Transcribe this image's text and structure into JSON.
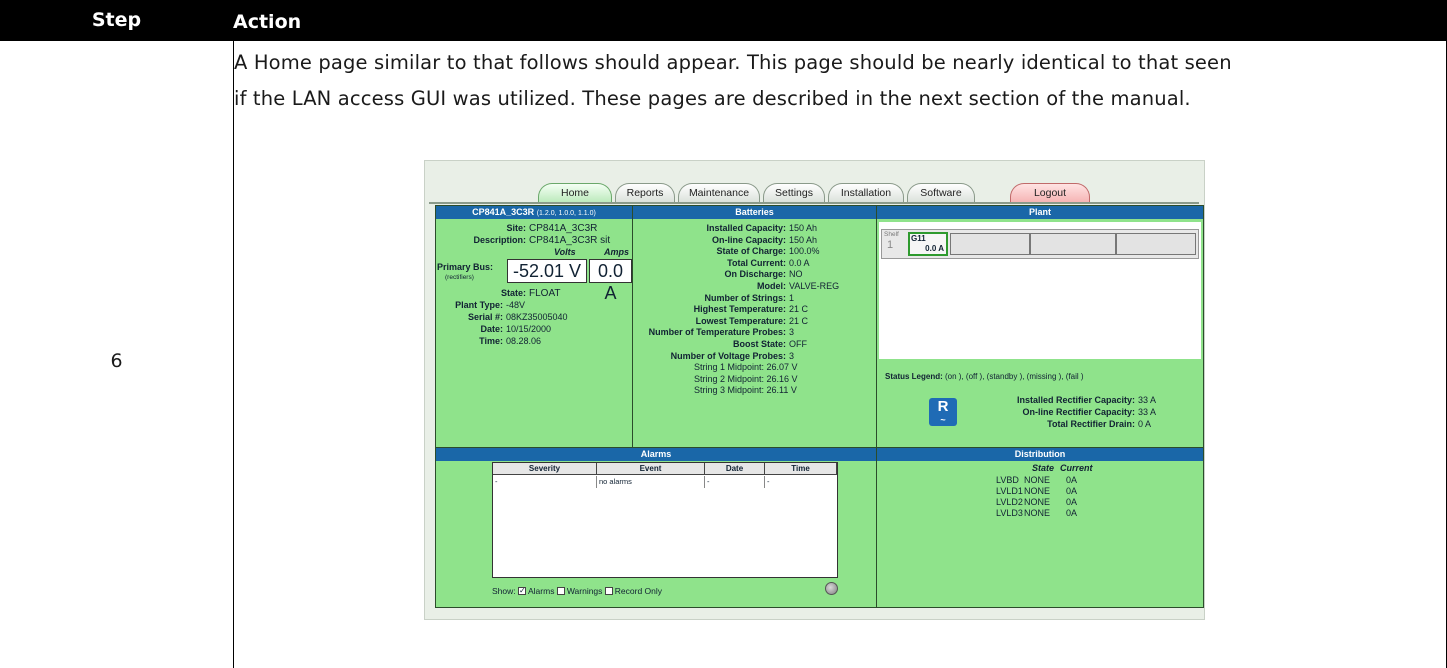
{
  "table": {
    "headers": [
      "Step",
      "Action"
    ],
    "step": "6",
    "paragraph_lines": [
      "A Home page similar to that follows should appear. This page should be nearly identical to that seen",
      "if the LAN access GUI was utilized. These pages are described in the next section of the manual."
    ]
  },
  "gui": {
    "tabs": [
      "Home",
      "Reports",
      "Maintenance",
      "Settings",
      "Installation",
      "Software",
      "Logout"
    ],
    "active_tab": "Home",
    "left": {
      "title": "CP841A_3C3R",
      "title_sub": "(1.2.0, 1.0.0, 1.1.0)",
      "site_label": "Site:",
      "site": "CP841A_3C3R",
      "desc_label": "Description:",
      "desc": "CP841A_3C3R sit",
      "volts_hdr": "Volts",
      "amps_hdr": "Amps",
      "bus_label": "Primary Bus:",
      "bus_sub": "(rectifiers)",
      "bus_volts": "-52.01 V",
      "bus_amps": "0.0 A",
      "state_label": "State:",
      "state": "FLOAT",
      "plant_type_label": "Plant Type:",
      "plant_type": "-48V",
      "serial_label": "Serial #:",
      "serial": "08KZ35005040",
      "date_label": "Date:",
      "date": "10/15/2000",
      "time_label": "Time:",
      "time": "08.28.06"
    },
    "batteries": {
      "title": "Batteries",
      "rows": [
        {
          "label": "Installed Capacity:",
          "value": "150 Ah"
        },
        {
          "label": "On-line Capacity:",
          "value": "150 Ah"
        },
        {
          "label": "State of Charge:",
          "value": "100.0%"
        },
        {
          "label": "Total Current:",
          "value": "0.0 A"
        },
        {
          "label": "On Discharge:",
          "value": "NO"
        },
        {
          "label": "Model:",
          "value": "VALVE-REG"
        },
        {
          "label": "Number of Strings:",
          "value": "1"
        },
        {
          "label": "Highest Temperature:",
          "value": "21 C"
        },
        {
          "label": "Lowest Temperature:",
          "value": "21 C"
        },
        {
          "label": "Number of Temperature Probes:",
          "value": "3"
        },
        {
          "label": "Boost State:",
          "value": "OFF"
        },
        {
          "label": "Number of Voltage Probes:",
          "value": "3"
        }
      ],
      "midpoints": [
        "String 1 Midpoint: 26.07 V",
        "String 2 Midpoint: 26.16 V",
        "String 3 Midpoint: 26.11 V"
      ]
    },
    "plant": {
      "title": "Plant",
      "shelf_label": "Shelf",
      "shelf_num": "1",
      "rect_id": "G11",
      "rect_amps": "0.0 A",
      "legend_label": "Status Legend:",
      "legend_text": "(on ), (off ), (standby ), (missing ), (fail )",
      "rows": [
        {
          "label": "Installed Rectifier Capacity:",
          "value": "33 A"
        },
        {
          "label": "On-line Rectifier Capacity:",
          "value": "33 A"
        },
        {
          "label": "Total Rectifier Drain:",
          "value": "0 A"
        }
      ],
      "logo_letter": "R"
    },
    "alarms": {
      "title": "Alarms",
      "columns": [
        "Severity",
        "Event",
        "Date",
        "Time"
      ],
      "row": [
        "-",
        "no alarms",
        "-",
        "-"
      ],
      "show_label": "Show:",
      "checks": [
        {
          "label": "Alarms",
          "checked": true
        },
        {
          "label": "Warnings",
          "checked": false
        },
        {
          "label": "Record Only",
          "checked": false
        }
      ]
    },
    "distribution": {
      "title": "Distribution",
      "state_hdr": "State",
      "current_hdr": "Current",
      "rows": [
        {
          "name": "LVBD",
          "state": "NONE",
          "current": "0A"
        },
        {
          "name": "LVLD1",
          "state": "NONE",
          "current": "0A"
        },
        {
          "name": "LVLD2",
          "state": "NONE",
          "current": "0A"
        },
        {
          "name": "LVLD3",
          "state": "NONE",
          "current": "0A"
        }
      ]
    }
  }
}
